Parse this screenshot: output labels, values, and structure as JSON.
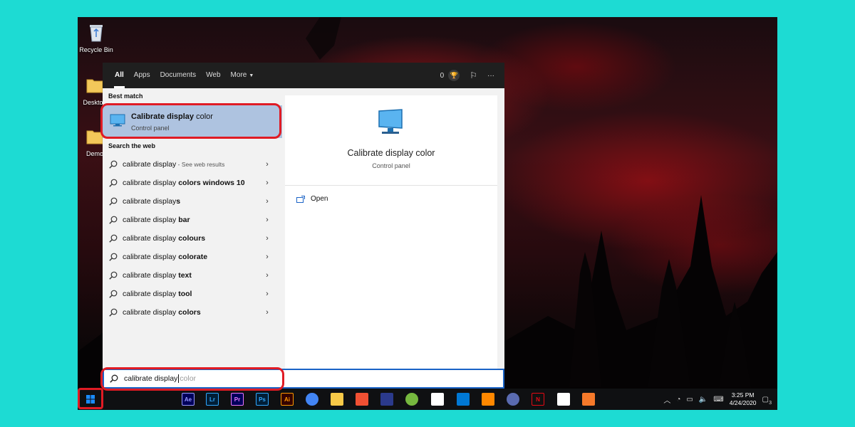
{
  "desktop": {
    "icons": [
      {
        "label": "Recycle Bin",
        "icon": "recycle-bin-icon"
      },
      {
        "label": "Desktop",
        "icon": "folder-icon"
      },
      {
        "label": "Demo",
        "icon": "folder-icon"
      }
    ]
  },
  "start_menu": {
    "tabs": [
      {
        "label": "All",
        "active": true
      },
      {
        "label": "Apps"
      },
      {
        "label": "Documents"
      },
      {
        "label": "Web"
      },
      {
        "label": "More"
      }
    ],
    "rewards_count": "0",
    "more_options": "···",
    "best_match_header": "Best match",
    "best_match": {
      "title_bold": "Calibrate display",
      "title_rest": " color",
      "subtitle": "Control panel"
    },
    "web_header": "Search the web",
    "web_results": [
      {
        "prefix": "calibrate display",
        "bold": "",
        "suffix": " - See web results"
      },
      {
        "prefix": "calibrate display ",
        "bold": "colors windows 10",
        "suffix": ""
      },
      {
        "prefix": "calibrate display",
        "bold": "s",
        "suffix": ""
      },
      {
        "prefix": "calibrate display ",
        "bold": "bar",
        "suffix": ""
      },
      {
        "prefix": "calibrate display ",
        "bold": "colours",
        "suffix": ""
      },
      {
        "prefix": "calibrate display ",
        "bold": "colorate",
        "suffix": ""
      },
      {
        "prefix": "calibrate display ",
        "bold": "text",
        "suffix": ""
      },
      {
        "prefix": "calibrate display ",
        "bold": "tool",
        "suffix": ""
      },
      {
        "prefix": "calibrate display ",
        "bold": "colors",
        "suffix": ""
      }
    ],
    "preview": {
      "title": "Calibrate display color",
      "subtitle": "Control panel",
      "action_open": "Open"
    },
    "search": {
      "typed": "calibrate display",
      "suggestion": "color"
    }
  },
  "taskbar": {
    "apps": [
      {
        "label": "Ae",
        "icon": "after-effects-icon",
        "color": "#00005b",
        "fg": "#9999ff"
      },
      {
        "label": "Lr",
        "icon": "lightroom-icon",
        "color": "#001e36",
        "fg": "#31a8ff"
      },
      {
        "label": "Pr",
        "icon": "premiere-icon",
        "color": "#00005b",
        "fg": "#ea77ff"
      },
      {
        "label": "Ps",
        "icon": "photoshop-icon",
        "color": "#001e36",
        "fg": "#31a8ff"
      },
      {
        "label": "Ai",
        "icon": "illustrator-icon",
        "color": "#330000",
        "fg": "#ff9a00"
      },
      {
        "label": "",
        "icon": "chrome-icon",
        "color": "#4285f4"
      },
      {
        "label": "",
        "icon": "file-explorer-icon",
        "color": "#f7c948"
      },
      {
        "label": "",
        "icon": "git-icon",
        "color": "#f05033"
      },
      {
        "label": "",
        "icon": "vpn-icon",
        "color": "#2b3a8c"
      },
      {
        "label": "",
        "icon": "utorrent-icon",
        "color": "#76b83f"
      },
      {
        "label": "",
        "icon": "store-icon",
        "color": "#ffffff"
      },
      {
        "label": "",
        "icon": "mail-icon",
        "color": "#0078d4"
      },
      {
        "label": "",
        "icon": "vlc-icon",
        "color": "#ff8800"
      },
      {
        "label": "",
        "icon": "davinci-icon",
        "color": "#5a6bb0"
      },
      {
        "label": "N",
        "icon": "netflix-icon",
        "color": "#111111",
        "fg": "#e50914"
      },
      {
        "label": "",
        "icon": "chat-icon",
        "color": "#ffffff"
      },
      {
        "label": "",
        "icon": "blender-icon",
        "color": "#f5792a"
      }
    ],
    "time": "3:25 PM",
    "date": "4/24/2020",
    "notification_count": "3"
  },
  "colors": {
    "highlight_outline": "#e01b24",
    "search_border": "#1a63c6",
    "best_match_bg": "#aec3e0"
  }
}
